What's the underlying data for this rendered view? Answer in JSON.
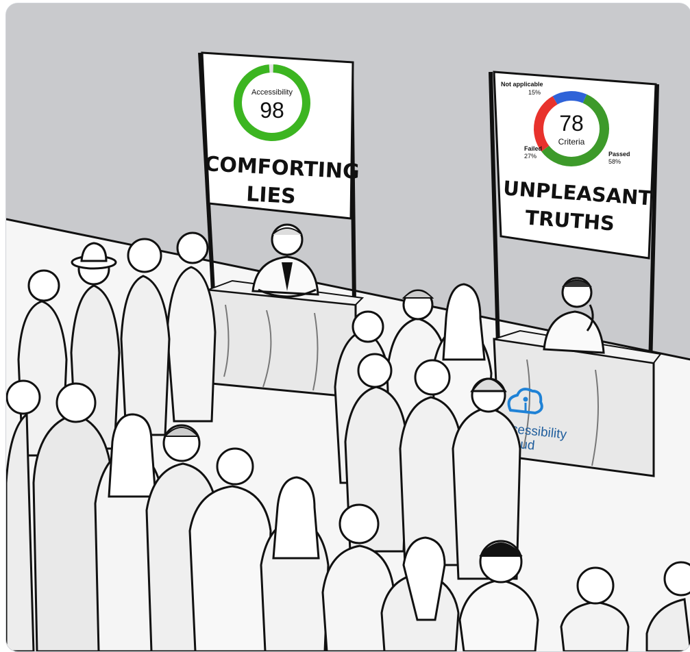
{
  "left_sign": {
    "gauge_label": "Accessibility",
    "score": "98",
    "score_fraction": 0.98,
    "caption_line1": "COMFORTING",
    "caption_line2": "LIES",
    "ring_color": "#3cb521"
  },
  "right_sign": {
    "score": "78",
    "unit": "Criteria",
    "segments": [
      {
        "label": "Not applicable",
        "pct": "15%",
        "value": 15,
        "color": "#2f63d8"
      },
      {
        "label": "Failed",
        "pct": "27%",
        "value": 27,
        "color": "#e8322c"
      },
      {
        "label": "Passed",
        "pct": "58%",
        "value": 58,
        "color": "#3d9a2a"
      }
    ],
    "caption_line1": "UNPLEASANT",
    "caption_line2": "TRUTHS"
  },
  "banner": {
    "brand_line1": "ccessibility",
    "brand_line2": "loud",
    "brand_color": "#1f82d6",
    "icon": "cloud-person-icon"
  }
}
